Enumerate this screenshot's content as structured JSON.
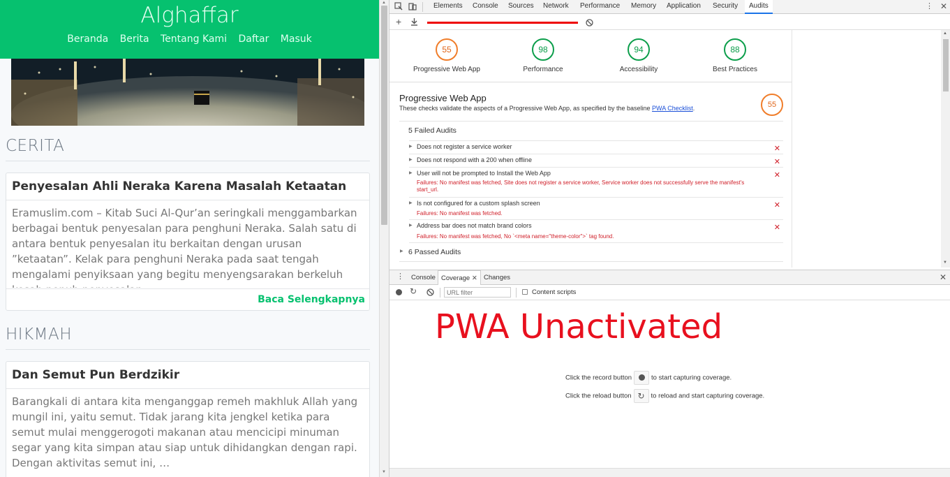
{
  "site": {
    "brand": "Alghaffar",
    "nav": [
      "Beranda",
      "Berita",
      "Tentang Kami",
      "Daftar",
      "Masuk"
    ],
    "sections": [
      {
        "title": "CERITA",
        "card": {
          "title": "Penyesalan Ahli Neraka Karena Masalah Ketaatan",
          "body": "Eramuslim.com – Kitab Suci Al-Qur’an seringkali menggambarkan berbagai bentuk penyesalan para penghuni Neraka. Salah satu di antara bentuk penyesalan itu berkaitan dengan urusan ”ketaatan”. Kelak para penghuni Neraka pada saat tengah mengalami penyiksaan yang begitu menyengsarakan berkeluh kesah penuh penyesalan …",
          "more": "Baca Selengkapnya"
        }
      },
      {
        "title": "HIKMAH",
        "card": {
          "title": "Dan Semut Pun Berdzikir",
          "body": "Barangkali di antara kita menganggap remeh makhluk Allah yang mungil ini, yaitu semut. Tidak jarang kita jengkel ketika para semut mulai menggerogoti makanan atau mencicipi minuman segar yang kita simpan atau siap untuk dihidangkan dengan rapi. Dengan aktivitas semut ini, …"
        }
      }
    ]
  },
  "devtools": {
    "tabs": [
      "Elements",
      "Console",
      "Sources",
      "Network",
      "Performance",
      "Memory",
      "Application",
      "Security",
      "Audits"
    ],
    "active_tab": "Audits",
    "gauges": [
      {
        "label": "Progressive Web App",
        "score": "55"
      },
      {
        "label": "Performance",
        "score": "98"
      },
      {
        "label": "Accessibility",
        "score": "94"
      },
      {
        "label": "Best Practices",
        "score": "88"
      }
    ],
    "pwa": {
      "title": "Progressive Web App",
      "desc_prefix": "These checks validate the aspects of a Progressive Web App, as specified by the baseline ",
      "desc_link": "PWA Checklist",
      "desc_suffix": ".",
      "score": "55",
      "failed_header": "5 Failed Audits",
      "passed_header": "6 Passed Audits",
      "audits": [
        {
          "text": "Does not register a service worker",
          "fail": ""
        },
        {
          "text": "Does not respond with a 200 when offline",
          "fail": ""
        },
        {
          "text": "User will not be prompted to Install the Web App",
          "fail": "Failures: No manifest was fetched, Site does not register a service worker, Service worker does not successfully serve the manifest's start_url."
        },
        {
          "text": "Is not configured for a custom splash screen",
          "fail": "Failures: No manifest was fetched."
        },
        {
          "text": "Address bar does not match brand colors",
          "fail": "Failures: No manifest was fetched, No `<meta name=\"theme-color\">` tag found."
        }
      ]
    },
    "drawer": {
      "tabs": [
        "Console",
        "Coverage",
        "Changes"
      ],
      "active": "Coverage",
      "filter_placeholder": "URL filter",
      "content_scripts": "Content scripts",
      "hint1_pre": "Click the record button",
      "hint1_post": "to start capturing coverage.",
      "hint2_pre": "Click the reload button",
      "hint2_post": "to reload and start capturing coverage."
    },
    "annotation": "PWA Unactivated"
  }
}
